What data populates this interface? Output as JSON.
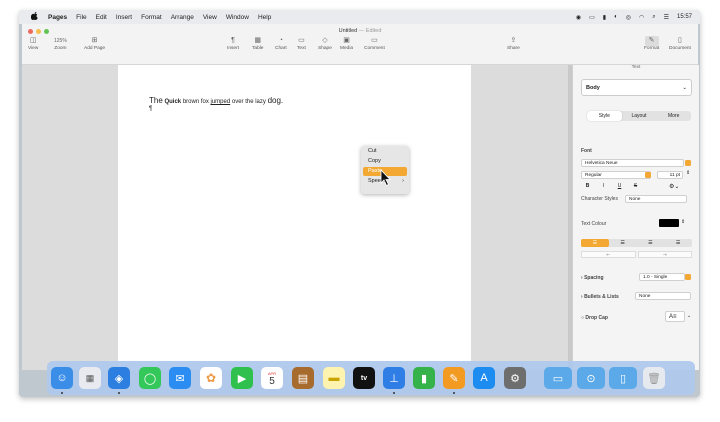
{
  "menubar": {
    "apple": "",
    "items": [
      "Pages",
      "File",
      "Edit",
      "Insert",
      "Format",
      "Arrange",
      "View",
      "Window",
      "Help"
    ],
    "clock": "15:57"
  },
  "window": {
    "title": "Untitled",
    "title_status": "— Edited",
    "toolbar": {
      "view": "View",
      "zoom_value": "125%",
      "zoom": "Zoom",
      "add_page": "Add Page",
      "insert": "Insert",
      "table": "Table",
      "chart": "Chart",
      "text": "Text",
      "shape": "Shape",
      "media": "Media",
      "comment": "Comment",
      "share": "Share",
      "format": "Format",
      "document": "Document"
    }
  },
  "document": {
    "words": [
      {
        "text": "The",
        "style": "big"
      },
      {
        "text": "Quick",
        "style": "bold"
      },
      {
        "text": "brown fox",
        "style": "plain"
      },
      {
        "text": "jumped",
        "style": "underline"
      },
      {
        "text": "over the lazy",
        "style": "plain"
      },
      {
        "text": "dog.",
        "style": "big"
      }
    ],
    "cursor_line": "¶"
  },
  "context_menu": {
    "items": [
      "Cut",
      "Copy",
      "Paste",
      "Speech"
    ],
    "highlighted": "Paste"
  },
  "inspector": {
    "header": "Text",
    "paragraph_style": "Body",
    "tabs": [
      "Style",
      "Layout",
      "More"
    ],
    "active_tab": "Style",
    "font_label": "Font",
    "font_name": "Helvetica Neue",
    "font_weight": "Regular",
    "font_size": "11 pt",
    "bold": "B",
    "italic": "I",
    "underline": "U",
    "strike": "S",
    "character_styles_label": "Character Styles",
    "character_styles_value": "None",
    "text_colour_label": "Text Colour",
    "spacing_label": "Spacing",
    "spacing_value": "1.0 - Single",
    "bullets_label": "Bullets & Lists",
    "bullets_value": "None",
    "drop_cap_label": "Drop Cap"
  },
  "colors": {
    "accent": "#f3a833",
    "dock": "#afc8eb",
    "canvas": "#dcdcdc"
  },
  "dock": {
    "calendar_month": "APR",
    "calendar_day": "5",
    "tv_label": "tv",
    "apps": [
      "finder-icon",
      "launchpad-icon",
      "safari-icon",
      "messages-icon",
      "mail-icon",
      "photos-icon",
      "facetime-icon",
      "calendar-icon",
      "notes-brown-icon",
      "notes-icon",
      "tv-icon",
      "keynote-icon",
      "numbers-icon",
      "pages-icon",
      "appstore-icon",
      "settings-icon",
      "folder-icon",
      "downloads-icon",
      "documents-icon",
      "trash-icon"
    ]
  }
}
